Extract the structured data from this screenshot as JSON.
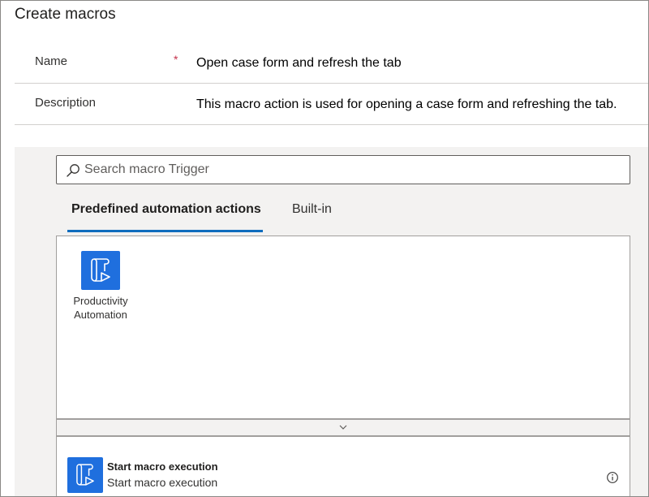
{
  "page": {
    "title": "Create macros"
  },
  "form": {
    "name_label": "Name",
    "required_marker": "*",
    "name_value": "Open case form and refresh the tab",
    "description_label": "Description",
    "description_value": "This macro action is used for opening a case form and refreshing the tab."
  },
  "designer": {
    "search": {
      "placeholder": "Search macro Trigger",
      "value": "",
      "icon": "search-icon"
    },
    "tabs": [
      {
        "label": "Predefined automation actions",
        "selected": true
      },
      {
        "label": "Built-in",
        "selected": false
      }
    ],
    "connectors": [
      {
        "label": "Productivity Automation",
        "icon": "macro-script-icon"
      }
    ],
    "expand_icon": "chevron-down-icon",
    "trigger": {
      "title": "Start macro execution",
      "subtitle": "Start macro execution",
      "icon": "macro-script-icon",
      "info_icon": "info-icon"
    }
  },
  "colors": {
    "accent": "#0f6cbd",
    "icon_background": "#1f6fde",
    "required": "#c4314b",
    "designer_background": "#f3f2f1"
  }
}
